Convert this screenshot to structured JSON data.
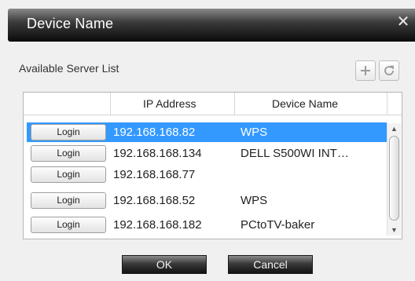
{
  "dialog": {
    "title": "Device Name",
    "close_symbol": "✕"
  },
  "server_list": {
    "label": "Available Server List",
    "add_icon": "plus-icon",
    "refresh_icon": "refresh-icon",
    "columns": [
      "",
      "IP Address",
      "Device Name"
    ],
    "rows": [
      {
        "button": "Login",
        "ip": "192.168.168.82",
        "device": "WPS",
        "selected": true
      },
      {
        "button": "Login",
        "ip": "192.168.168.134",
        "device": "DELL S500WI INT…",
        "selected": false
      },
      {
        "button": "Login",
        "ip": "192.168.168.77",
        "device": "",
        "selected": false
      },
      {
        "button": "Login",
        "ip": "192.168.168.52",
        "device": "WPS",
        "selected": false
      },
      {
        "button": "Login",
        "ip": "192.168.168.182",
        "device": "PCtoTV-baker",
        "selected": false
      }
    ]
  },
  "buttons": {
    "ok": "OK",
    "cancel": "Cancel"
  },
  "colors": {
    "selection": "#3399ff",
    "title_bar": "#1a1a1a"
  }
}
